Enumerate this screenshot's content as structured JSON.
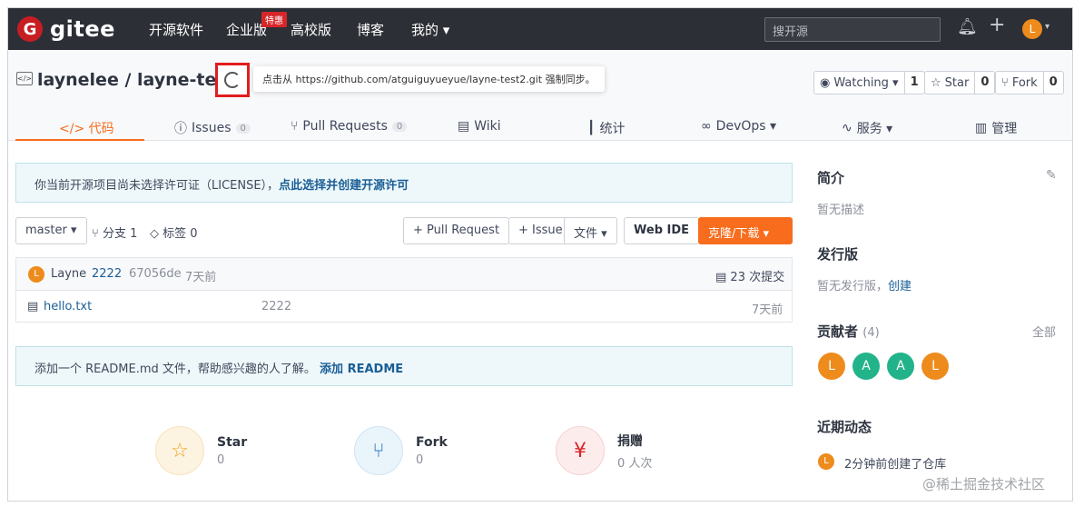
{
  "nav": {
    "logo_letter": "G",
    "logo_text": "gitee",
    "items": [
      "开源软件",
      "企业版",
      "高校版",
      "博客",
      "我的 ▾"
    ],
    "hot_badge": "特惠",
    "search_placeholder": "搜开源",
    "avatar_letter": "L"
  },
  "repo": {
    "icon_text": "</>",
    "title": "laynelee / layne-test2",
    "sync_tooltip": "点击从 https://github.com/atguiguyueyue/layne-test2.git 强制同步。",
    "watching_label": "Watching ▾",
    "watching_count": "1",
    "star_label": "Star",
    "star_count": "0",
    "fork_label": "Fork",
    "fork_count": "0"
  },
  "tabs": [
    {
      "label": "</> 代码"
    },
    {
      "label": "Issues",
      "count": "0"
    },
    {
      "label": "Pull Requests",
      "count": "0"
    },
    {
      "label": "Wiki"
    },
    {
      "label": "统计"
    },
    {
      "label": "DevOps ▾"
    },
    {
      "label": "服务 ▾"
    },
    {
      "label": "管理"
    }
  ],
  "license": {
    "text": "你当前开源项目尚未选择许可证（LICENSE），",
    "link": "点此选择并创建开源许可"
  },
  "toolbar": {
    "branch": "master ▾",
    "branches": "分支 1",
    "tags": "标签 0",
    "pull_request": "+ Pull Request",
    "issue": "+ Issue",
    "file": "文件 ▾",
    "web_ide": "Web IDE",
    "clone": "克隆/下载 ▾"
  },
  "commit": {
    "avatar": "L",
    "author": "Layne",
    "message": "2222",
    "hash": "67056de",
    "time": "7天前",
    "count": "23 次提交"
  },
  "files": [
    {
      "name": "hello.txt",
      "message": "2222",
      "time": "7天前"
    }
  ],
  "readme": {
    "text": "添加一个 README.md 文件，帮助感兴趣的人了解。",
    "link": "添加 README"
  },
  "stats": [
    {
      "title": "Star",
      "value": "0"
    },
    {
      "title": "Fork",
      "value": "0"
    },
    {
      "title": "捐赠",
      "value": "0 人次"
    }
  ],
  "sidebar": {
    "intro_title": "简介",
    "intro_text": "暂无描述",
    "release_title": "发行版",
    "release_text": "暂无发行版，",
    "release_link": "创建",
    "contrib_title": "贡献者",
    "contrib_count": "(4)",
    "contrib_all": "全部",
    "contributors": [
      "L",
      "A",
      "A",
      "L"
    ],
    "activity_title": "近期动态",
    "activity_avatar": "L",
    "activity_text": "2分钟前创建了仓库"
  },
  "colors": {
    "accent": "#f76d1d",
    "brand_red": "#c71d23",
    "link": "#1b5e96",
    "contrib_orange": "#ee8b1d",
    "contrib_green": "#22b38a"
  },
  "watermark": "@稀土掘金技术社区"
}
